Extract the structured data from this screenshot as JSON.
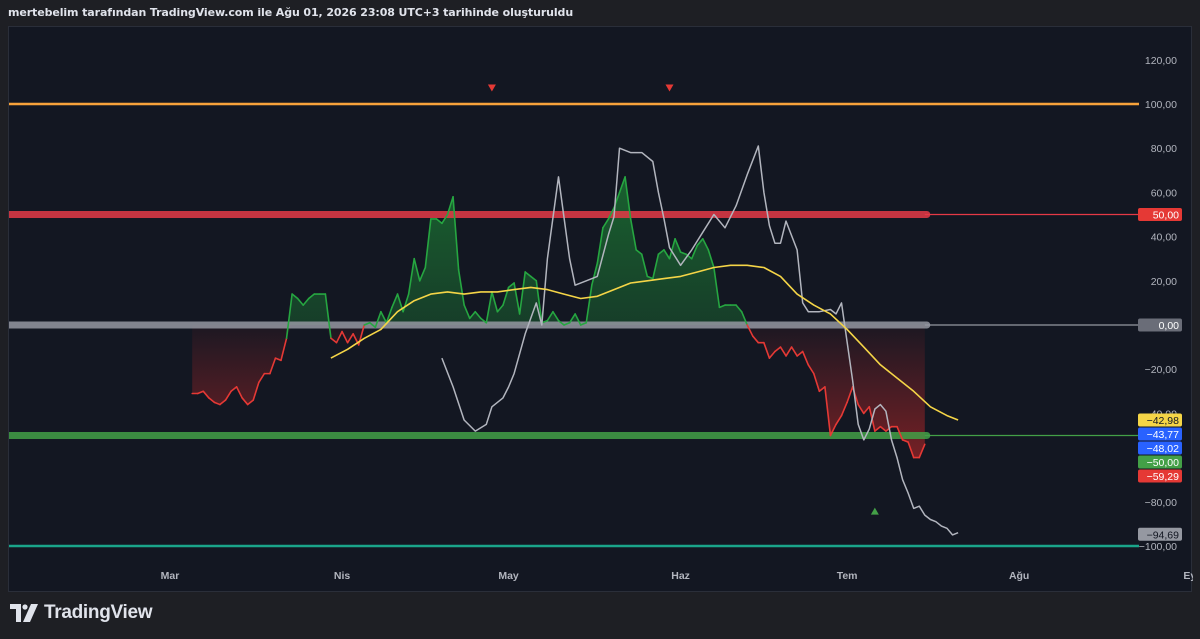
{
  "header": {
    "caption": "mertebelim tarafından TradingView.com ile Ağu 01, 2026 23:08 UTC+3 tarihinde oluşturuldu"
  },
  "footer": {
    "brand": "TradingView"
  },
  "chart_data": {
    "type": "line",
    "ylim": [
      -105,
      130
    ],
    "y_ticks": [
      {
        "v": 120,
        "label": "120,00"
      },
      {
        "v": 100,
        "label": "100,00"
      },
      {
        "v": 80,
        "label": "80,00"
      },
      {
        "v": 60,
        "label": "60,00"
      },
      {
        "v": 40,
        "label": "40,00"
      },
      {
        "v": 20,
        "label": "20,00"
      },
      {
        "v": -20,
        "label": "−20,00"
      },
      {
        "v": -40,
        "label": "−40,00"
      },
      {
        "v": -80,
        "label": "−80,00"
      },
      {
        "v": -100,
        "label": "−100,00"
      }
    ],
    "x_ticks": [
      {
        "day": 0,
        "label": "Mar"
      },
      {
        "day": 31,
        "label": "Nis"
      },
      {
        "day": 61,
        "label": "May"
      },
      {
        "day": 92,
        "label": "Haz"
      },
      {
        "day": 122,
        "label": "Tem"
      },
      {
        "day": 153,
        "label": "Ağu"
      },
      {
        "day": 184,
        "label": "Eyl"
      }
    ],
    "levels": [
      {
        "name": "100,00",
        "value": 100,
        "color": "#f7a23b",
        "show_tag": false
      },
      {
        "name": "50,00",
        "value": 50,
        "color": "#e53946",
        "show_tag": true,
        "band": true
      },
      {
        "name": "0,00",
        "value": 0,
        "color": "#9598a1",
        "show_tag": true,
        "band": true
      },
      {
        "name": "-50,00",
        "value": -50,
        "color": "#43a047",
        "show_tag": true,
        "band": true
      },
      {
        "name": "-100,00",
        "value": -100,
        "color": "#1aa58a",
        "show_tag": false
      }
    ],
    "oscillator": {
      "color_up": "#26a641",
      "color_down": "#e53935",
      "points": [
        [
          4,
          -31
        ],
        [
          5,
          -31
        ],
        [
          6,
          -30
        ],
        [
          7,
          -33
        ],
        [
          8,
          -35
        ],
        [
          9,
          -36
        ],
        [
          10,
          -34
        ],
        [
          11,
          -30
        ],
        [
          12,
          -28
        ],
        [
          13,
          -33
        ],
        [
          14,
          -36
        ],
        [
          15,
          -34
        ],
        [
          16,
          -26
        ],
        [
          17,
          -22
        ],
        [
          18,
          -22
        ],
        [
          19,
          -15
        ],
        [
          20,
          -16
        ],
        [
          21,
          -6
        ],
        [
          22,
          14
        ],
        [
          23,
          12
        ],
        [
          24,
          9
        ],
        [
          25,
          12
        ],
        [
          26,
          14
        ],
        [
          27,
          14
        ],
        [
          28,
          14
        ],
        [
          29,
          -6
        ],
        [
          30,
          -8
        ],
        [
          31,
          -3
        ],
        [
          32,
          -8
        ],
        [
          33,
          -4
        ],
        [
          34,
          -9
        ],
        [
          35,
          0
        ],
        [
          36,
          1
        ],
        [
          37,
          -1
        ],
        [
          38,
          6
        ],
        [
          39,
          1
        ],
        [
          40,
          8
        ],
        [
          41,
          14
        ],
        [
          42,
          6
        ],
        [
          43,
          14
        ],
        [
          44,
          30
        ],
        [
          45,
          20
        ],
        [
          46,
          26
        ],
        [
          47,
          48
        ],
        [
          48,
          48
        ],
        [
          49,
          46
        ],
        [
          50,
          50
        ],
        [
          51,
          58
        ],
        [
          52,
          25
        ],
        [
          53,
          9
        ],
        [
          54,
          3
        ],
        [
          55,
          6
        ],
        [
          56,
          3
        ],
        [
          57,
          1
        ],
        [
          58,
          15
        ],
        [
          59,
          6
        ],
        [
          60,
          9
        ],
        [
          61,
          17
        ],
        [
          62,
          19
        ],
        [
          63,
          5
        ],
        [
          64,
          24
        ],
        [
          65,
          22
        ],
        [
          66,
          20
        ],
        [
          67,
          1
        ],
        [
          68,
          2
        ],
        [
          69,
          6
        ],
        [
          70,
          2
        ],
        [
          71,
          0
        ],
        [
          72,
          1
        ],
        [
          73,
          5
        ],
        [
          74,
          0
        ],
        [
          75,
          1
        ],
        [
          76,
          18
        ],
        [
          77,
          28
        ],
        [
          78,
          44
        ],
        [
          79,
          48
        ],
        [
          80,
          53
        ],
        [
          81,
          60
        ],
        [
          82,
          67
        ],
        [
          83,
          48
        ],
        [
          84,
          34
        ],
        [
          85,
          32
        ],
        [
          86,
          22
        ],
        [
          87,
          21
        ],
        [
          88,
          32
        ],
        [
          89,
          34
        ],
        [
          90,
          30
        ],
        [
          91,
          39
        ],
        [
          92,
          33
        ],
        [
          93,
          32
        ],
        [
          94,
          30
        ],
        [
          95,
          36
        ],
        [
          96,
          39
        ],
        [
          97,
          34
        ],
        [
          98,
          26
        ],
        [
          99,
          8
        ],
        [
          100,
          9
        ],
        [
          101,
          9
        ],
        [
          102,
          9
        ],
        [
          103,
          6
        ],
        [
          104,
          0
        ],
        [
          105,
          -5
        ],
        [
          106,
          -8
        ],
        [
          107,
          -8
        ],
        [
          108,
          -15
        ],
        [
          109,
          -12
        ],
        [
          110,
          -10
        ],
        [
          111,
          -14
        ],
        [
          112,
          -10
        ],
        [
          113,
          -14
        ],
        [
          114,
          -12
        ],
        [
          115,
          -18
        ],
        [
          116,
          -22
        ],
        [
          117,
          -30
        ],
        [
          118,
          -28
        ],
        [
          119,
          -50
        ],
        [
          120,
          -45
        ],
        [
          121,
          -41
        ],
        [
          122,
          -35
        ],
        [
          123,
          -28
        ],
        [
          124,
          -36
        ],
        [
          125,
          -40
        ],
        [
          126,
          -37
        ],
        [
          127,
          -48
        ],
        [
          128,
          -46
        ],
        [
          129,
          -48
        ],
        [
          130,
          -46
        ],
        [
          131,
          -46
        ],
        [
          132,
          -52
        ],
        [
          133,
          -53
        ],
        [
          134,
          -60
        ],
        [
          135,
          -60
        ],
        [
          136,
          -54
        ]
      ]
    },
    "signal": {
      "color": "#f5d547",
      "points": [
        [
          29,
          -15
        ],
        [
          32,
          -11
        ],
        [
          35,
          -6
        ],
        [
          38,
          -2
        ],
        [
          41,
          6
        ],
        [
          44,
          11
        ],
        [
          47,
          14
        ],
        [
          50,
          15
        ],
        [
          53,
          14
        ],
        [
          56,
          15
        ],
        [
          59,
          15
        ],
        [
          62,
          16
        ],
        [
          65,
          17
        ],
        [
          68,
          16
        ],
        [
          71,
          14
        ],
        [
          74,
          12
        ],
        [
          77,
          13
        ],
        [
          80,
          16
        ],
        [
          83,
          19
        ],
        [
          86,
          20
        ],
        [
          89,
          21
        ],
        [
          92,
          22
        ],
        [
          95,
          24
        ],
        [
          98,
          26
        ],
        [
          101,
          27
        ],
        [
          104,
          27
        ],
        [
          107,
          26
        ],
        [
          110,
          22
        ],
        [
          113,
          14
        ],
        [
          116,
          9
        ],
        [
          119,
          5
        ],
        [
          122,
          -2
        ],
        [
          125,
          -10
        ],
        [
          128,
          -18
        ],
        [
          131,
          -24
        ],
        [
          134,
          -30
        ],
        [
          137,
          -37
        ],
        [
          140,
          -41
        ],
        [
          142,
          -43
        ]
      ]
    },
    "price": {
      "color": "#b2b5be",
      "points": [
        [
          49,
          -15
        ],
        [
          51,
          -28
        ],
        [
          53,
          -43
        ],
        [
          55,
          -48
        ],
        [
          57,
          -45
        ],
        [
          58,
          -37
        ],
        [
          60,
          -33
        ],
        [
          61,
          -28
        ],
        [
          62,
          -22
        ],
        [
          64,
          -4
        ],
        [
          66,
          10
        ],
        [
          67,
          0
        ],
        [
          68,
          30
        ],
        [
          70,
          67
        ],
        [
          72,
          30
        ],
        [
          73,
          18
        ],
        [
          75,
          20
        ],
        [
          77,
          22
        ],
        [
          79,
          41
        ],
        [
          80,
          49
        ],
        [
          81,
          80
        ],
        [
          83,
          78
        ],
        [
          85,
          78
        ],
        [
          87,
          74
        ],
        [
          88,
          60
        ],
        [
          89,
          48
        ],
        [
          90,
          35
        ],
        [
          92,
          27
        ],
        [
          94,
          34
        ],
        [
          96,
          42
        ],
        [
          98,
          50
        ],
        [
          100,
          44
        ],
        [
          102,
          54
        ],
        [
          104,
          68
        ],
        [
          106,
          81
        ],
        [
          107,
          60
        ],
        [
          108,
          45
        ],
        [
          109,
          37
        ],
        [
          110,
          37
        ],
        [
          111,
          47
        ],
        [
          113,
          34
        ],
        [
          114,
          10
        ],
        [
          115,
          6
        ],
        [
          117,
          6
        ],
        [
          119,
          7
        ],
        [
          120,
          5
        ],
        [
          121,
          10
        ],
        [
          123,
          -25
        ],
        [
          124,
          -45
        ],
        [
          125,
          -52
        ],
        [
          126,
          -47
        ],
        [
          127,
          -38
        ],
        [
          128,
          -36
        ],
        [
          129,
          -39
        ],
        [
          130,
          -52
        ],
        [
          131,
          -60
        ],
        [
          132,
          -70
        ],
        [
          133,
          -76
        ],
        [
          134,
          -83
        ],
        [
          135,
          -82
        ],
        [
          136,
          -86
        ],
        [
          137,
          -88
        ],
        [
          138,
          -89
        ],
        [
          139,
          -91
        ],
        [
          140,
          -92
        ],
        [
          141,
          -95
        ],
        [
          142,
          -94
        ]
      ]
    },
    "markers": [
      {
        "day": 58,
        "value": 107,
        "shape": "down",
        "color": "#e53935"
      },
      {
        "day": 90,
        "value": 107,
        "shape": "down",
        "color": "#e53935"
      },
      {
        "day": 127,
        "value": -84,
        "shape": "up",
        "color": "#43a047"
      }
    ],
    "price_tags": [
      {
        "value": -42.98,
        "label": "−42,98",
        "bg": "#f5d547",
        "fg": "#131722"
      },
      {
        "value": -43.77,
        "label": "−43,77",
        "bg": "#2962ff",
        "fg": "#ffffff"
      },
      {
        "value": -48.02,
        "label": "−48,02",
        "bg": "#2962ff",
        "fg": "#ffffff"
      },
      {
        "value": -50,
        "label": "−50,00",
        "bg": "#43a047",
        "fg": "#ffffff"
      },
      {
        "value": -59.29,
        "label": "−59,29",
        "bg": "#e53935",
        "fg": "#ffffff"
      },
      {
        "value": 50,
        "label": "50,00",
        "bg": "#e53935",
        "fg": "#ffffff"
      },
      {
        "value": 0,
        "label": "0,00",
        "bg": "#6a6d78",
        "fg": "#ffffff"
      },
      {
        "value": -94.69,
        "label": "−94,69",
        "bg": "#9598a1",
        "fg": "#131722"
      }
    ]
  }
}
